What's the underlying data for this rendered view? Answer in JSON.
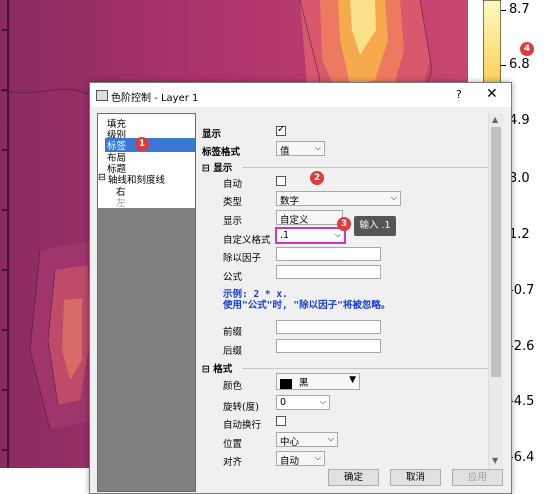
{
  "colorbar": {
    "ticks": [
      "8.7",
      "6.8",
      "4.9",
      "3.0",
      "1.2",
      "-0.7",
      "-2.6",
      "-4.5",
      "-6.4"
    ]
  },
  "dialog": {
    "title": "色阶控制 - Layer 1",
    "help": "?",
    "close": "✕"
  },
  "tree": {
    "items": [
      "填充",
      "级别",
      "标签",
      "布局",
      "标题",
      "轴线和刻度线",
      "右",
      "左"
    ],
    "selected_index": 2
  },
  "panel": {
    "display_label": "显示",
    "display_checked": true,
    "label_format_label": "标签格式",
    "label_format_value": "值",
    "section_display": "显示",
    "auto_label": "自动",
    "auto_checked": false,
    "type_label": "类型",
    "type_value": "数字",
    "display2_label": "显示",
    "display2_value": "自定义",
    "custom_format_label": "自定义格式",
    "custom_format_value": ".1",
    "divide_label": "除以因子",
    "formula_label": "公式",
    "note_line1": "示例: 2 * x.",
    "note_line2": "使用\"公式\"时, \"除以因子\"将被忽略。",
    "prefix_label": "前缀",
    "suffix_label": "后缀",
    "section_format": "格式",
    "color_label": "颜色",
    "color_value": "黑",
    "rotate_label": "旋转(度)",
    "rotate_value": "0",
    "wrap_label": "自动换行",
    "wrap_checked": false,
    "position_label": "位置",
    "position_value": "中心",
    "align_label": "对齐",
    "align_value": "自动"
  },
  "annotations": {
    "badge1": "1",
    "badge2": "2",
    "badge3": "3",
    "badge4": "4",
    "tooltip": "输入 .1"
  },
  "buttons": {
    "ok": "确定",
    "cancel": "取消",
    "apply": "应用"
  },
  "colors": {
    "accent_red": "#e03a3a",
    "selection_blue": "#3a78d4",
    "highlight_border": "#c838c8",
    "note_blue": "#1a3dd6"
  }
}
